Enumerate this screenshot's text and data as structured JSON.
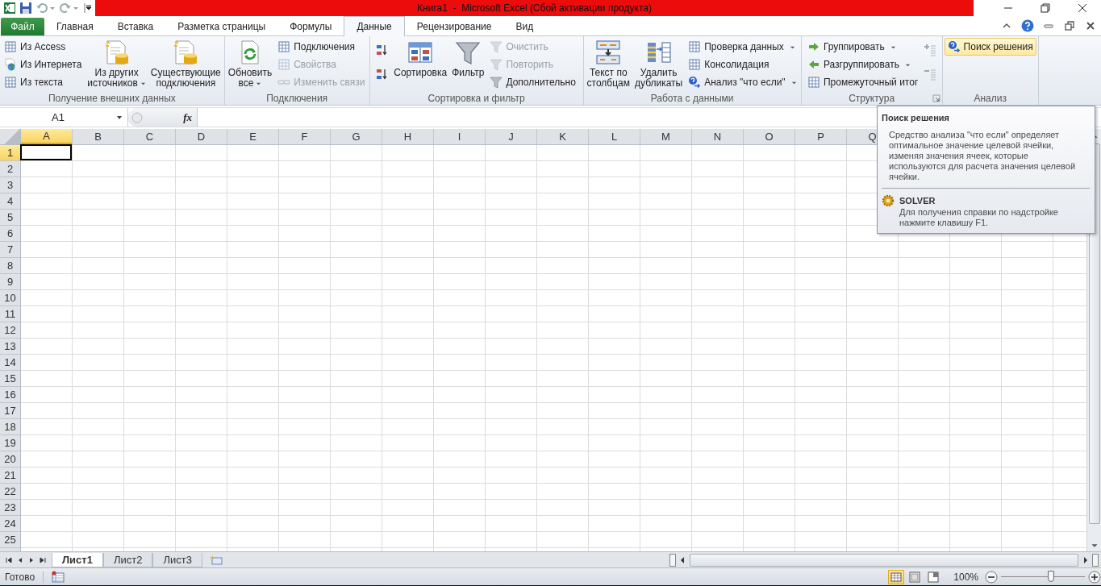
{
  "title_bar": {
    "title": "Книга1  -  Microsoft Excel (Сбой активации продукта)"
  },
  "tabs": [
    {
      "label": "Файл",
      "kind": "file",
      "selected": false
    },
    {
      "label": "Главная",
      "kind": "tab",
      "selected": false
    },
    {
      "label": "Вставка",
      "kind": "tab",
      "selected": false
    },
    {
      "label": "Разметка страницы",
      "kind": "tab",
      "selected": false
    },
    {
      "label": "Формулы",
      "kind": "tab",
      "selected": false
    },
    {
      "label": "Данные",
      "kind": "tab",
      "selected": true
    },
    {
      "label": "Рецензирование",
      "kind": "tab",
      "selected": false
    },
    {
      "label": "Вид",
      "kind": "tab",
      "selected": false
    }
  ],
  "ribbon": {
    "groups": [
      {
        "label": "Получение внешних данных",
        "launcher": false,
        "items": [
          {
            "kind": "stack",
            "items": [
              {
                "label": "Из Access",
                "disabled": false,
                "menu": false
              },
              {
                "label": "Из Интернета",
                "disabled": false,
                "menu": false
              },
              {
                "label": "Из текста",
                "disabled": false,
                "menu": false
              }
            ]
          },
          {
            "kind": "large",
            "lines": [
              "Из других",
              "источников"
            ],
            "menu": true,
            "disabled": false
          },
          {
            "kind": "large",
            "lines": [
              "Существующие",
              "подключения"
            ],
            "menu": false,
            "disabled": false
          }
        ]
      },
      {
        "label": "Подключения",
        "launcher": false,
        "items": [
          {
            "kind": "large",
            "lines": [
              "Обновить",
              "все"
            ],
            "menu": true,
            "disabled": false
          },
          {
            "kind": "stack",
            "items": [
              {
                "label": "Подключения",
                "disabled": false,
                "menu": false
              },
              {
                "label": "Свойства",
                "disabled": true,
                "menu": false
              },
              {
                "label": "Изменить связи",
                "disabled": true,
                "menu": false
              }
            ]
          }
        ]
      },
      {
        "label": "Сортировка и фильтр",
        "launcher": false,
        "items": [
          {
            "kind": "icons",
            "items": [
              {
                "disabled": false
              },
              {
                "disabled": false
              }
            ]
          },
          {
            "kind": "large",
            "lines": [
              "Сортировка"
            ],
            "menu": false,
            "disabled": false
          },
          {
            "kind": "large",
            "lines": [
              "Фильтр"
            ],
            "menu": false,
            "disabled": false
          },
          {
            "kind": "stack",
            "items": [
              {
                "label": "Очистить",
                "disabled": true,
                "menu": false
              },
              {
                "label": "Повторить",
                "disabled": true,
                "menu": false
              },
              {
                "label": "Дополнительно",
                "disabled": false,
                "menu": false
              }
            ]
          }
        ]
      },
      {
        "label": "Работа с данными",
        "launcher": false,
        "items": [
          {
            "kind": "large",
            "lines": [
              "Текст по",
              "столбцам"
            ],
            "menu": false,
            "disabled": false
          },
          {
            "kind": "large",
            "lines": [
              "Удалить",
              "дубликаты"
            ],
            "menu": false,
            "disabled": false
          },
          {
            "kind": "stack",
            "items": [
              {
                "label": "Проверка данных",
                "disabled": false,
                "menu": true
              },
              {
                "label": "Консолидация",
                "disabled": false,
                "menu": false
              },
              {
                "label": "Анализ \"что если\"",
                "disabled": false,
                "menu": true
              }
            ]
          }
        ]
      },
      {
        "label": "Структура",
        "launcher": true,
        "items": [
          {
            "kind": "stack",
            "items": [
              {
                "label": "Группировать",
                "disabled": false,
                "menu": true
              },
              {
                "label": "Разгруппировать",
                "disabled": false,
                "menu": true
              },
              {
                "label": "Промежуточный итог",
                "disabled": false,
                "menu": false
              }
            ]
          },
          {
            "kind": "icons",
            "items": [
              {
                "disabled": false
              },
              {
                "disabled": false
              }
            ]
          }
        ]
      },
      {
        "label": "Анализ",
        "launcher": false,
        "items": [
          {
            "kind": "stack",
            "items": [
              {
                "label": "Поиск решения",
                "disabled": false,
                "menu": false,
                "highlighted": true
              }
            ]
          }
        ]
      }
    ]
  },
  "formula_bar": {
    "name_box": "A1",
    "fx": "fx"
  },
  "columns": [
    {
      "label": "A",
      "selected": true
    },
    {
      "label": "B",
      "selected": false
    },
    {
      "label": "C",
      "selected": false
    },
    {
      "label": "D",
      "selected": false
    },
    {
      "label": "E",
      "selected": false
    },
    {
      "label": "F",
      "selected": false
    },
    {
      "label": "G",
      "selected": false
    },
    {
      "label": "H",
      "selected": false
    },
    {
      "label": "I",
      "selected": false
    },
    {
      "label": "J",
      "selected": false
    },
    {
      "label": "K",
      "selected": false
    },
    {
      "label": "L",
      "selected": false
    },
    {
      "label": "M",
      "selected": false
    },
    {
      "label": "N",
      "selected": false
    },
    {
      "label": "O",
      "selected": false
    },
    {
      "label": "P",
      "selected": false
    },
    {
      "label": "Q",
      "selected": false
    }
  ],
  "rows": [
    {
      "label": "1",
      "selected": true
    },
    {
      "label": "2",
      "selected": false
    },
    {
      "label": "3",
      "selected": false
    },
    {
      "label": "4",
      "selected": false
    },
    {
      "label": "5",
      "selected": false
    },
    {
      "label": "6",
      "selected": false
    },
    {
      "label": "7",
      "selected": false
    },
    {
      "label": "8",
      "selected": false
    },
    {
      "label": "9",
      "selected": false
    },
    {
      "label": "10",
      "selected": false
    },
    {
      "label": "11",
      "selected": false
    },
    {
      "label": "12",
      "selected": false
    },
    {
      "label": "13",
      "selected": false
    },
    {
      "label": "14",
      "selected": false
    },
    {
      "label": "15",
      "selected": false
    },
    {
      "label": "16",
      "selected": false
    },
    {
      "label": "17",
      "selected": false
    },
    {
      "label": "18",
      "selected": false
    },
    {
      "label": "19",
      "selected": false
    },
    {
      "label": "20",
      "selected": false
    },
    {
      "label": "21",
      "selected": false
    },
    {
      "label": "22",
      "selected": false
    },
    {
      "label": "23",
      "selected": false
    },
    {
      "label": "24",
      "selected": false
    },
    {
      "label": "25",
      "selected": false
    }
  ],
  "tooltip": {
    "title": "Поиск решения",
    "text": "Средство анализа \"что если\" определяет оптимальное значение целевой ячейки, изменяя значения ячеек, которые используются для расчета значения целевой ячейки.",
    "addin": "SOLVER",
    "help": "Для получения справки по надстройке нажмите клавишу F1."
  },
  "sheet_tabs": [
    {
      "label": "Лист1",
      "selected": true
    },
    {
      "label": "Лист2",
      "selected": false
    },
    {
      "label": "Лист3",
      "selected": false
    }
  ],
  "status_bar": {
    "text": "Готово",
    "views": [
      {
        "kind": "normal",
        "selected": true
      },
      {
        "kind": "layout",
        "selected": false
      },
      {
        "kind": "pagebreak",
        "selected": false
      }
    ],
    "zoom": {
      "reading": "100%",
      "level": 0.6
    }
  }
}
